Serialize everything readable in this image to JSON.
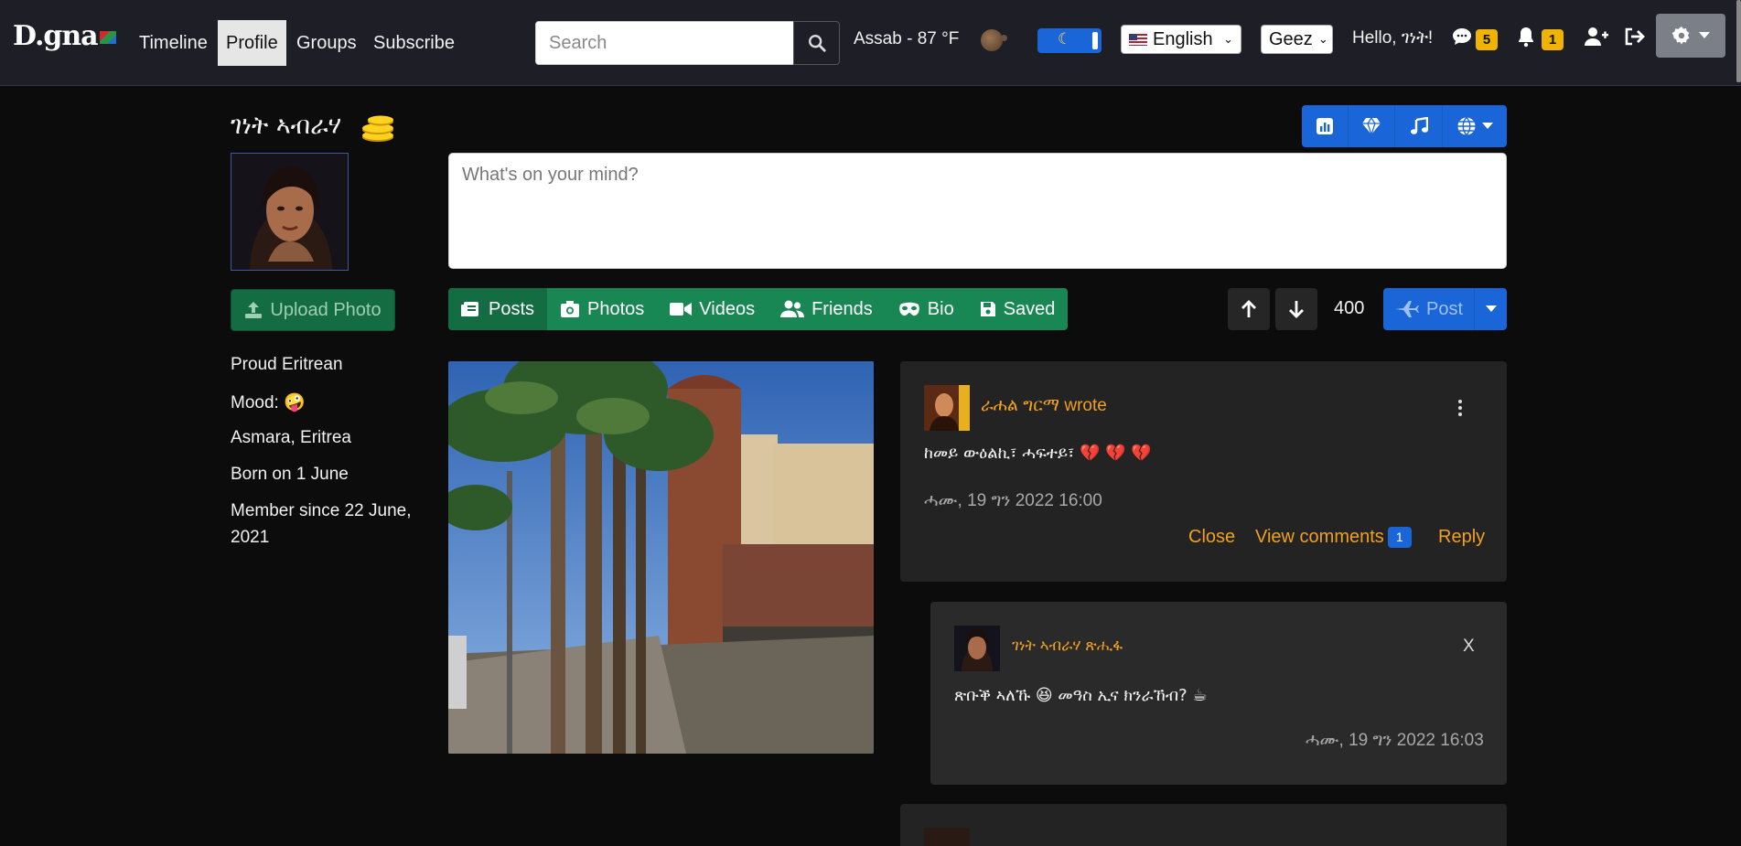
{
  "navbar": {
    "logo": "D.gna",
    "links": [
      "Timeline",
      "Profile",
      "Groups",
      "Subscribe"
    ],
    "active_link": "Profile",
    "search_placeholder": "Search",
    "weather": "Assab - 87 °F",
    "language": "English",
    "script": "Geez",
    "greeting": "Hello, ገነት!",
    "messages_count": "5",
    "notifications_count": "1"
  },
  "profile": {
    "name": "ገነት ኣብራሃ",
    "upload_label": "Upload Photo",
    "bio": {
      "tagline": "Proud Eritrean",
      "mood_label": "Mood:",
      "mood_emoji": "🤪",
      "location": "Asmara, Eritrea",
      "born": "Born on 1 June",
      "member_since_line1": "Member since 22 June,",
      "member_since_line2": "2021"
    }
  },
  "composer": {
    "placeholder": "What's on your mind?",
    "char_count": "400",
    "post_label": "Post"
  },
  "tabs": [
    "Posts",
    "Photos",
    "Videos",
    "Friends",
    "Bio",
    "Saved"
  ],
  "active_tab": "Posts",
  "post": {
    "author": "ራሐል ግርማ wrote",
    "text": "ከመይ ውዕልኪ፣ ሓፍተይ፣",
    "hearts": "💔 💔 💔",
    "time": "ሓሙ, 19 ግን 2022 16:00",
    "close_label": "Close",
    "view_comments_label": "View comments",
    "comments_count": "1",
    "reply_label": "Reply"
  },
  "reply": {
    "author": "ገነት ኣብራሃ ጽሒፋ",
    "text": "ጽቡቕ ኣለኹ 😆 መዓስ ኢና ክንራኸብ? ☕",
    "time": "ሓሙ, 19 ግን 2022 16:03",
    "close_label": "X"
  },
  "colors": {
    "navbar_bg": "#1e1e26",
    "accent_blue": "#1a66d9",
    "accent_green": "#198754",
    "link_orange": "#f0a020",
    "badge_yellow": "#f0b400"
  },
  "icons": [
    "search-icon",
    "moon-icon",
    "sms-icon",
    "bell-icon",
    "user-plus-icon",
    "sign-out-icon",
    "gear-icon",
    "coins-icon",
    "upload-icon",
    "chart-icon",
    "gem-icon",
    "music-icon",
    "globe-icon",
    "arrow-up-icon",
    "arrow-down-icon",
    "plane-icon",
    "caret-down-icon",
    "kebab-icon"
  ]
}
